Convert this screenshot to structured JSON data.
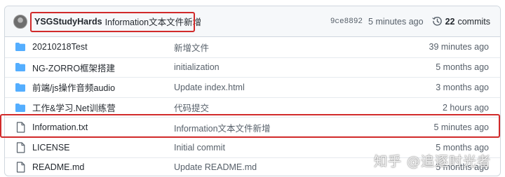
{
  "latest_commit": {
    "author": "YSGStudyHards",
    "message": "Information文本文件新增",
    "sha": "9ce8892",
    "time": "5 minutes ago",
    "commits_count": "22",
    "commits_label": "commits"
  },
  "files": [
    {
      "type": "folder",
      "name": "20210218Test",
      "message": "新增文件",
      "age": "39 minutes ago"
    },
    {
      "type": "folder",
      "name": "NG-ZORRO框架搭建",
      "message": "initialization",
      "age": "5 months ago"
    },
    {
      "type": "folder",
      "name": "前端/js操作音频audio",
      "message": "Update index.html",
      "age": "3 months ago"
    },
    {
      "type": "folder",
      "name": "工作&学习.Net训练营",
      "message": "代码提交",
      "age": "2 hours ago"
    },
    {
      "type": "file",
      "name": "Information.txt",
      "message": "Information文本文件新增",
      "age": "5 minutes ago"
    },
    {
      "type": "file",
      "name": "LICENSE",
      "message": "Initial commit",
      "age": "5 months ago"
    },
    {
      "type": "file",
      "name": "README.md",
      "message": "Update README.md",
      "age": "5 months ago"
    }
  ],
  "watermark": "知乎 @追逐时光者",
  "colors": {
    "folder_icon": "#54aeff",
    "file_icon": "#57606a",
    "highlight": "#d12a2a"
  }
}
